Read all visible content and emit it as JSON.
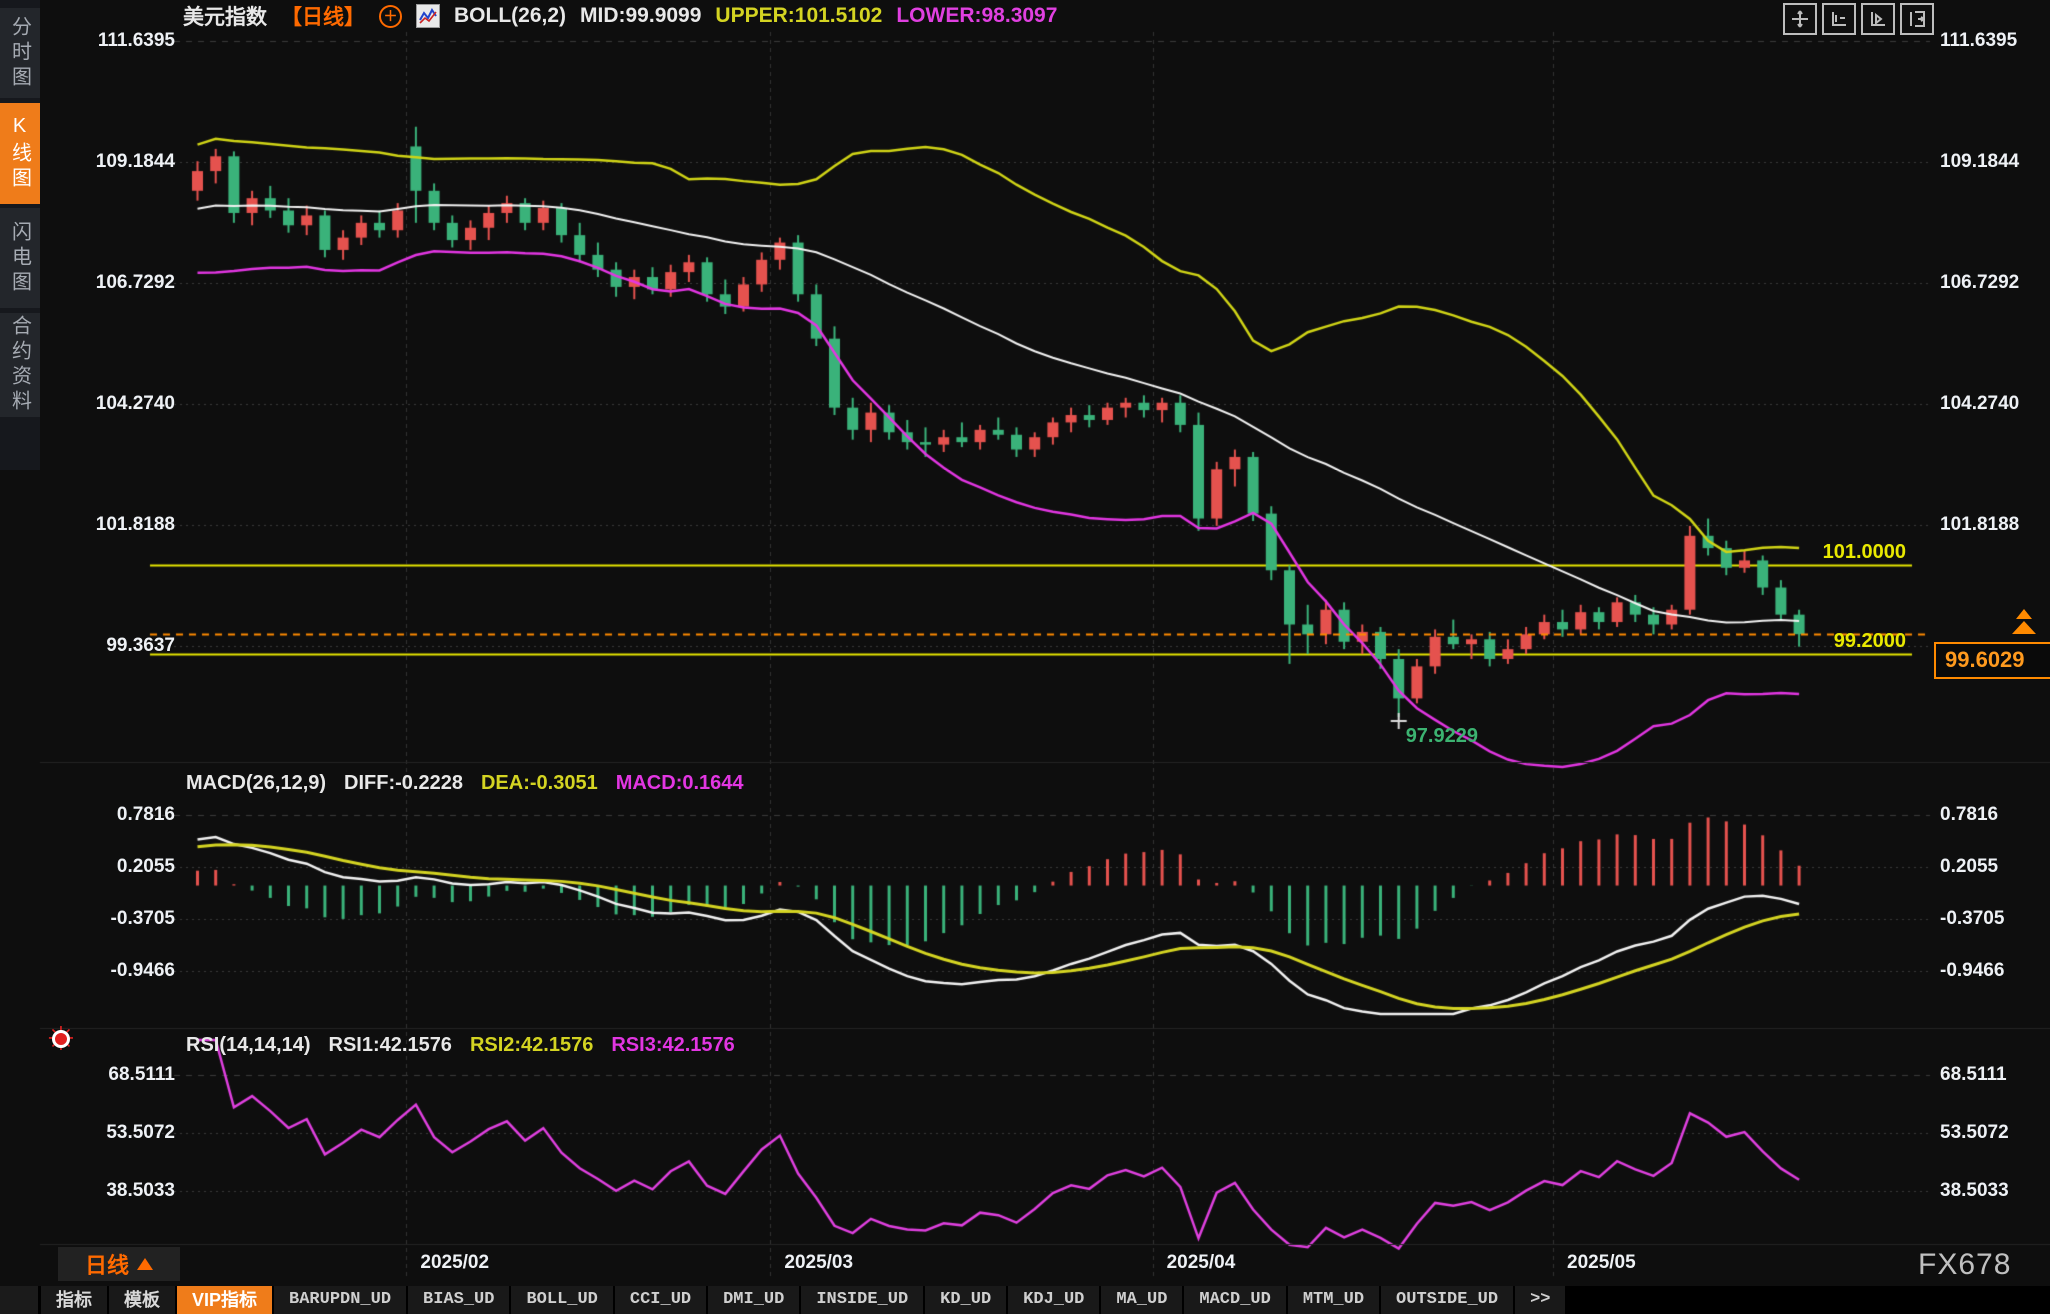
{
  "sidebar": {
    "items": [
      {
        "label": "分时图",
        "active": false
      },
      {
        "label": "K线图",
        "active": true
      },
      {
        "label": "闪电图",
        "active": false
      },
      {
        "label": "合约资料",
        "active": false
      }
    ]
  },
  "header": {
    "symbol": "美元指数",
    "period_tag": "【日线】",
    "boll_title": "BOLL(26,2)",
    "mid": "MID:99.9099",
    "upper": "UPPER:101.5102",
    "lower": "LOWER:98.3097"
  },
  "macd_header": {
    "title": "MACD(26,12,9)",
    "diff": "DIFF:-0.2228",
    "dea": "DEA:-0.3051",
    "macd": "MACD:0.1644"
  },
  "rsi_header": {
    "title": "RSI(14,14,14)",
    "rsi1": "RSI1:42.1576",
    "rsi2": "RSI2:42.1576",
    "rsi3": "RSI3:42.1576"
  },
  "footer": {
    "period": "日线",
    "watermark": "FX678"
  },
  "bottom_tabs": {
    "items": [
      {
        "label": "指标",
        "mono": false,
        "active": false
      },
      {
        "label": "模板",
        "mono": false,
        "active": false
      },
      {
        "label": "VIP指标",
        "mono": false,
        "active": true
      },
      {
        "label": "BARUPDN_UD",
        "mono": true,
        "active": false
      },
      {
        "label": "BIAS_UD",
        "mono": true,
        "active": false
      },
      {
        "label": "BOLL_UD",
        "mono": true,
        "active": false
      },
      {
        "label": "CCI_UD",
        "mono": true,
        "active": false
      },
      {
        "label": "DMI_UD",
        "mono": true,
        "active": false
      },
      {
        "label": "INSIDE_UD",
        "mono": true,
        "active": false
      },
      {
        "label": "KD_UD",
        "mono": true,
        "active": false
      },
      {
        "label": "KDJ_UD",
        "mono": true,
        "active": false
      },
      {
        "label": "MA_UD",
        "mono": true,
        "active": false
      },
      {
        "label": "MACD_UD",
        "mono": true,
        "active": false
      },
      {
        "label": "MTM_UD",
        "mono": true,
        "active": false
      },
      {
        "label": "OUTSIDE_UD",
        "mono": true,
        "active": false
      },
      {
        "label": ">>",
        "mono": true,
        "active": false
      }
    ]
  },
  "colors": {
    "up": "#e5524e",
    "down": "#3ab27a",
    "boll_upper": "#d0d416",
    "boll_mid": "#f2f2f2",
    "boll_lower": "#e236e2",
    "macd_diff": "#f2f2f2",
    "macd_dea": "#d4d422",
    "rsi_line": "#e040e0",
    "accent_orange": "#ef7c1a",
    "yellow_line": "#e6e600",
    "price_orange": "#ff8a00",
    "grid": "#3a3a3a",
    "text": "#eef1f5",
    "green_text": "#3cb371"
  },
  "chart_data": {
    "type": "candlestick+indicators",
    "title": "美元指数 日线",
    "main": {
      "yticks": [
        111.6395,
        109.1844,
        106.7292,
        104.274,
        101.8188,
        99.3637
      ],
      "boll": {
        "period": 26,
        "width": 2,
        "mid": 99.9099,
        "upper": 101.5102,
        "lower": 98.3097
      },
      "horizontal_lines": [
        {
          "value": 101.0,
          "label": "101.0000"
        },
        {
          "value": 99.2,
          "label": "99.2000"
        }
      ],
      "current_price": 99.6029,
      "current_price_label": "99.6029",
      "low_marker": {
        "index": 66,
        "value": 97.9229,
        "label": "97.9229"
      },
      "warmup_closes": [
        106.9,
        107.1,
        107.4,
        107.7,
        108.0,
        108.2,
        108.1,
        108.3,
        108.5,
        108.4,
        108.7,
        108.9,
        109.1,
        108.8,
        108.7
      ],
      "candles": [
        [
          108.6,
          109.2,
          108.4,
          109.0
        ],
        [
          109.0,
          109.45,
          108.75,
          109.3
        ],
        [
          109.3,
          109.4,
          107.95,
          108.15
        ],
        [
          108.15,
          108.6,
          107.9,
          108.45
        ],
        [
          108.45,
          108.7,
          108.05,
          108.2
        ],
        [
          108.2,
          108.45,
          107.75,
          107.9
        ],
        [
          107.9,
          108.3,
          107.7,
          108.1
        ],
        [
          108.1,
          108.2,
          107.25,
          107.4
        ],
        [
          107.4,
          107.8,
          107.2,
          107.65
        ],
        [
          107.65,
          108.1,
          107.5,
          107.95
        ],
        [
          107.95,
          108.2,
          107.65,
          107.8
        ],
        [
          107.8,
          108.35,
          107.65,
          108.2
        ],
        [
          109.5,
          109.9,
          107.95,
          108.6
        ],
        [
          108.6,
          108.75,
          107.8,
          107.95
        ],
        [
          107.95,
          108.1,
          107.45,
          107.6
        ],
        [
          107.6,
          108.0,
          107.4,
          107.85
        ],
        [
          107.85,
          108.3,
          107.6,
          108.15
        ],
        [
          108.15,
          108.5,
          107.95,
          108.35
        ],
        [
          108.35,
          108.45,
          107.8,
          107.95
        ],
        [
          107.95,
          108.4,
          107.8,
          108.25
        ],
        [
          108.25,
          108.35,
          107.55,
          107.7
        ],
        [
          107.7,
          107.95,
          107.15,
          107.3
        ],
        [
          107.3,
          107.55,
          106.85,
          107.0
        ],
        [
          107.0,
          107.15,
          106.45,
          106.65
        ],
        [
          106.65,
          107.0,
          106.4,
          106.85
        ],
        [
          106.85,
          107.05,
          106.5,
          106.6
        ],
        [
          106.6,
          107.1,
          106.45,
          106.95
        ],
        [
          106.95,
          107.3,
          106.75,
          107.15
        ],
        [
          107.15,
          107.25,
          106.35,
          106.5
        ],
        [
          106.5,
          106.8,
          106.1,
          106.25
        ],
        [
          106.25,
          106.85,
          106.15,
          106.7
        ],
        [
          106.7,
          107.35,
          106.55,
          107.2
        ],
        [
          107.2,
          107.65,
          107.0,
          107.55
        ],
        [
          107.55,
          107.7,
          106.35,
          106.5
        ],
        [
          106.5,
          106.7,
          105.45,
          105.6
        ],
        [
          105.6,
          105.85,
          104.05,
          104.2
        ],
        [
          104.2,
          104.4,
          103.55,
          103.75
        ],
        [
          103.75,
          104.3,
          103.5,
          104.1
        ],
        [
          104.1,
          104.25,
          103.55,
          103.7
        ],
        [
          103.7,
          103.95,
          103.35,
          103.5
        ],
        [
          103.5,
          103.8,
          103.2,
          103.45
        ],
        [
          103.45,
          103.75,
          103.3,
          103.6
        ],
        [
          103.6,
          103.9,
          103.4,
          103.5
        ],
        [
          103.5,
          103.85,
          103.35,
          103.75
        ],
        [
          103.75,
          104.0,
          103.55,
          103.65
        ],
        [
          103.65,
          103.8,
          103.2,
          103.35
        ],
        [
          103.35,
          103.7,
          103.2,
          103.6
        ],
        [
          103.6,
          104.0,
          103.45,
          103.9
        ],
        [
          103.9,
          104.2,
          103.7,
          104.05
        ],
        [
          104.05,
          104.25,
          103.8,
          103.95
        ],
        [
          103.95,
          104.3,
          103.85,
          104.2
        ],
        [
          104.2,
          104.4,
          104.0,
          104.3
        ],
        [
          104.3,
          104.45,
          104.0,
          104.15
        ],
        [
          104.15,
          104.4,
          103.9,
          104.3
        ],
        [
          104.3,
          104.45,
          103.7,
          103.85
        ],
        [
          103.85,
          104.1,
          101.7,
          101.95
        ],
        [
          101.95,
          103.1,
          101.8,
          102.95
        ],
        [
          102.95,
          103.35,
          102.6,
          103.2
        ],
        [
          103.2,
          103.3,
          101.9,
          102.05
        ],
        [
          102.05,
          102.2,
          100.7,
          100.9
        ],
        [
          100.9,
          101.0,
          99.0,
          99.8
        ],
        [
          99.8,
          100.2,
          99.2,
          99.6
        ],
        [
          99.6,
          100.3,
          99.4,
          100.1
        ],
        [
          100.1,
          100.25,
          99.3,
          99.45
        ],
        [
          99.45,
          99.8,
          99.2,
          99.65
        ],
        [
          99.65,
          99.75,
          98.9,
          99.1
        ],
        [
          99.1,
          99.3,
          97.9229,
          98.3
        ],
        [
          98.3,
          99.1,
          98.2,
          98.95
        ],
        [
          98.95,
          99.7,
          98.8,
          99.55
        ],
        [
          99.55,
          99.9,
          99.3,
          99.4
        ],
        [
          99.4,
          99.6,
          99.1,
          99.5
        ],
        [
          99.5,
          99.65,
          98.95,
          99.1
        ],
        [
          99.1,
          99.5,
          99.0,
          99.3
        ],
        [
          99.3,
          99.75,
          99.2,
          99.6
        ],
        [
          99.6,
          100.0,
          99.5,
          99.85
        ],
        [
          99.85,
          100.1,
          99.55,
          99.7
        ],
        [
          99.7,
          100.2,
          99.6,
          100.05
        ],
        [
          100.05,
          100.15,
          99.7,
          99.85
        ],
        [
          99.85,
          100.35,
          99.75,
          100.25
        ],
        [
          100.25,
          100.4,
          99.85,
          100.0
        ],
        [
          100.0,
          100.15,
          99.6,
          99.8
        ],
        [
          99.8,
          100.2,
          99.7,
          100.1
        ],
        [
          100.1,
          101.8,
          100.0,
          101.6
        ],
        [
          101.6,
          101.95,
          101.2,
          101.35
        ],
        [
          101.35,
          101.5,
          100.8,
          100.95
        ],
        [
          100.95,
          101.3,
          100.85,
          101.1
        ],
        [
          101.1,
          101.2,
          100.4,
          100.55
        ],
        [
          100.55,
          100.7,
          99.9,
          100.0
        ],
        [
          100.0,
          100.1,
          99.35,
          99.6029
        ]
      ],
      "xlabels": [
        {
          "index": 12,
          "label": "2025/02"
        },
        {
          "index": 32,
          "label": "2025/03"
        },
        {
          "index": 53,
          "label": "2025/04"
        },
        {
          "index": 75,
          "label": "2025/05"
        }
      ]
    },
    "macd": {
      "params": [
        26,
        12,
        9
      ],
      "diff": -0.2228,
      "dea": -0.3051,
      "macd": 0.1644,
      "yticks": [
        0.7816,
        0.2055,
        -0.3705,
        -0.9466
      ]
    },
    "rsi": {
      "params": [
        14,
        14,
        14
      ],
      "rsi1": 42.1576,
      "rsi2": 42.1576,
      "rsi3": 42.1576,
      "yticks": [
        68.5111,
        53.5072,
        38.5033
      ]
    }
  }
}
